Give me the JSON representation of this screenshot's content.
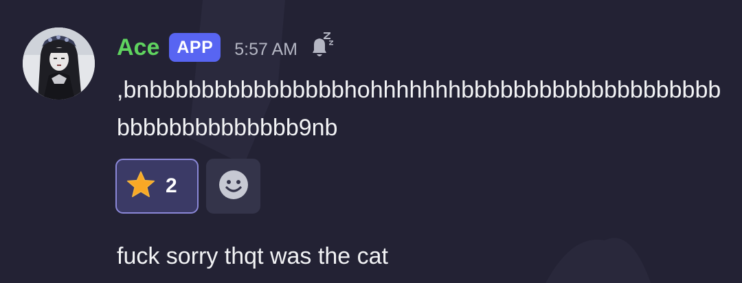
{
  "message": {
    "author": "Ace",
    "badge": "APP",
    "timestamp": "5:57 AM",
    "status_icon": "bell-sleep-icon",
    "content": ",bnbbbbbbbbbbbbbbbhohhhhhhhbbbbbbbbbbbbbbbbbbbbbbbbbbbbbbbbbb9nb",
    "avatar": "avatar-image"
  },
  "reactions": {
    "star": {
      "emoji": "star-icon",
      "count": "2"
    },
    "add": {
      "icon": "add-reaction-smile-icon"
    }
  },
  "followup": {
    "content": "fuck sorry thqt was the cat"
  },
  "colors": {
    "background": "#232234",
    "username": "#5fd35f",
    "badge": "#5865f2",
    "timestamp": "#b5b7c4",
    "reaction_selected_bg": "#3b3a66",
    "reaction_selected_border": "#8b88d8",
    "star": "#f9a825"
  }
}
